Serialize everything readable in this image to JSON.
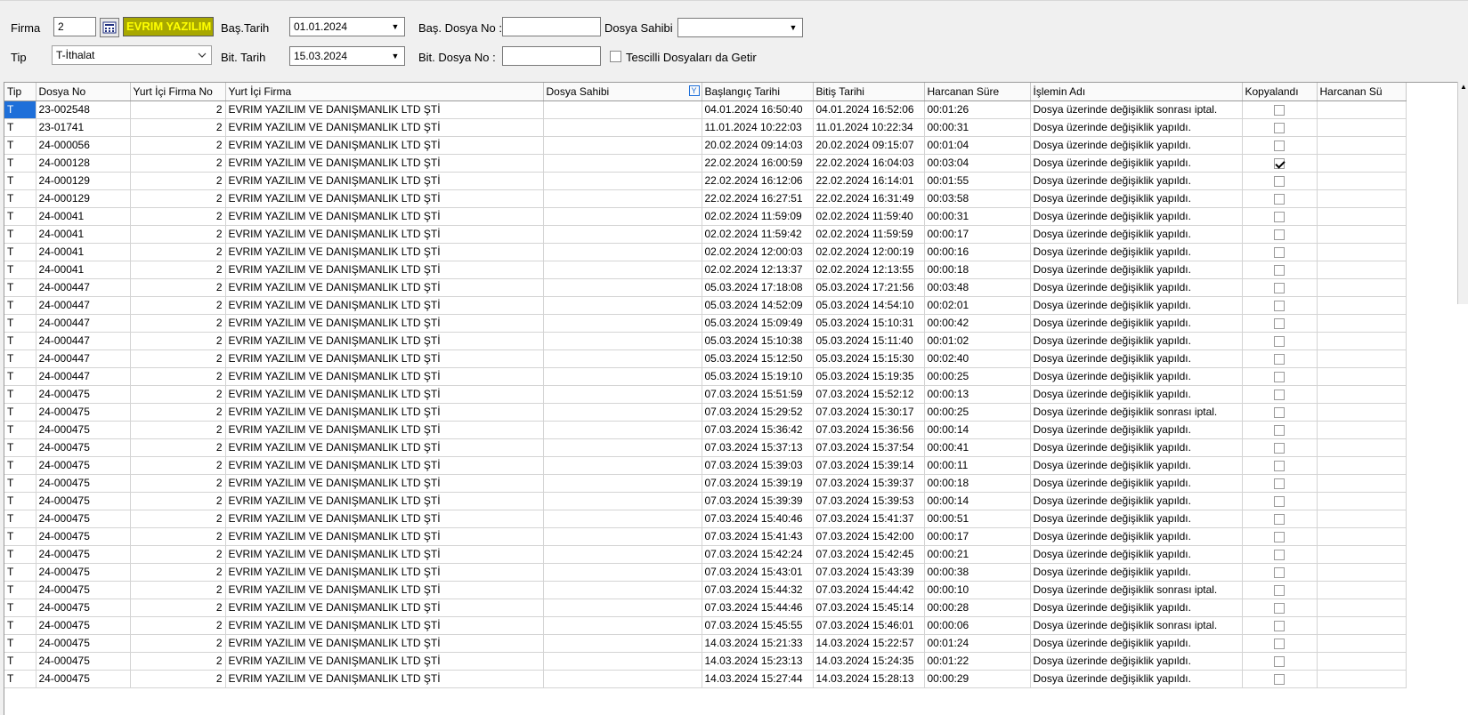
{
  "filters": {
    "firma_label": "Firma",
    "firma_value": "2",
    "firma_name": "EVRIM YAZILIM",
    "tip_label": "Tip",
    "tip_value": "T-İthalat",
    "bas_tarih_label": "Baş.Tarih",
    "bas_tarih_value": "01.01.2024",
    "bit_tarih_label": "Bit. Tarih",
    "bit_tarih_value": "15.03.2024",
    "bas_dosya_label": "Baş. Dosya No :",
    "bas_dosya_value": "",
    "bit_dosya_label": "Bit. Dosya No :",
    "bit_dosya_value": "",
    "dosya_sahibi_label": "Dosya Sahibi",
    "dosya_sahibi_value": "",
    "tescilli_label": "Tescilli Dosyaları da Getir"
  },
  "columns": [
    "Tip",
    "Dosya No",
    "Yurt İçi Firma No",
    "Yurt İçi Firma",
    "Dosya Sahibi",
    "Başlangıç Tarihi",
    "Bitiş Tarihi",
    "Harcanan Süre",
    "İşlemin Adı",
    "Kopyalandı",
    "Harcanan Sü"
  ],
  "rows": [
    {
      "tip": "T",
      "dosya": "23-002548",
      "firma_no": "2",
      "firma": "EVRIM YAZILIM VE DANIŞMANLIK LTD ŞTİ",
      "sahibi": "",
      "bas": "04.01.2024 16:50:40",
      "bit": "04.01.2024 16:52:06",
      "sure": "00:01:26",
      "islem": "Dosya üzerinde değişiklik sonrası iptal.",
      "kopya": false
    },
    {
      "tip": "T",
      "dosya": "23-01741",
      "firma_no": "2",
      "firma": "EVRIM YAZILIM VE DANIŞMANLIK LTD ŞTİ",
      "sahibi": "",
      "bas": "11.01.2024 10:22:03",
      "bit": "11.01.2024 10:22:34",
      "sure": "00:00:31",
      "islem": "Dosya üzerinde değişiklik yapıldı.",
      "kopya": false
    },
    {
      "tip": "T",
      "dosya": "24-000056",
      "firma_no": "2",
      "firma": "EVRIM YAZILIM VE DANIŞMANLIK LTD ŞTİ",
      "sahibi": "",
      "bas": "20.02.2024 09:14:03",
      "bit": "20.02.2024 09:15:07",
      "sure": "00:01:04",
      "islem": "Dosya üzerinde değişiklik yapıldı.",
      "kopya": false
    },
    {
      "tip": "T",
      "dosya": "24-000128",
      "firma_no": "2",
      "firma": "EVRIM YAZILIM VE DANIŞMANLIK LTD ŞTİ",
      "sahibi": "",
      "bas": "22.02.2024 16:00:59",
      "bit": "22.02.2024 16:04:03",
      "sure": "00:03:04",
      "islem": "Dosya üzerinde değişiklik yapıldı.",
      "kopya": true
    },
    {
      "tip": "T",
      "dosya": "24-000129",
      "firma_no": "2",
      "firma": "EVRIM YAZILIM VE DANIŞMANLIK LTD ŞTİ",
      "sahibi": "",
      "bas": "22.02.2024 16:12:06",
      "bit": "22.02.2024 16:14:01",
      "sure": "00:01:55",
      "islem": "Dosya üzerinde değişiklik yapıldı.",
      "kopya": false
    },
    {
      "tip": "T",
      "dosya": "24-000129",
      "firma_no": "2",
      "firma": "EVRIM YAZILIM VE DANIŞMANLIK LTD ŞTİ",
      "sahibi": "",
      "bas": "22.02.2024 16:27:51",
      "bit": "22.02.2024 16:31:49",
      "sure": "00:03:58",
      "islem": "Dosya üzerinde değişiklik yapıldı.",
      "kopya": false
    },
    {
      "tip": "T",
      "dosya": "24-00041",
      "firma_no": "2",
      "firma": "EVRIM YAZILIM VE DANIŞMANLIK LTD ŞTİ",
      "sahibi": "",
      "bas": "02.02.2024 11:59:09",
      "bit": "02.02.2024 11:59:40",
      "sure": "00:00:31",
      "islem": "Dosya üzerinde değişiklik yapıldı.",
      "kopya": false
    },
    {
      "tip": "T",
      "dosya": "24-00041",
      "firma_no": "2",
      "firma": "EVRIM YAZILIM VE DANIŞMANLIK LTD ŞTİ",
      "sahibi": "",
      "bas": "02.02.2024 11:59:42",
      "bit": "02.02.2024 11:59:59",
      "sure": "00:00:17",
      "islem": "Dosya üzerinde değişiklik yapıldı.",
      "kopya": false
    },
    {
      "tip": "T",
      "dosya": "24-00041",
      "firma_no": "2",
      "firma": "EVRIM YAZILIM VE DANIŞMANLIK LTD ŞTİ",
      "sahibi": "",
      "bas": "02.02.2024 12:00:03",
      "bit": "02.02.2024 12:00:19",
      "sure": "00:00:16",
      "islem": "Dosya üzerinde değişiklik yapıldı.",
      "kopya": false
    },
    {
      "tip": "T",
      "dosya": "24-00041",
      "firma_no": "2",
      "firma": "EVRIM YAZILIM VE DANIŞMANLIK LTD ŞTİ",
      "sahibi": "",
      "bas": "02.02.2024 12:13:37",
      "bit": "02.02.2024 12:13:55",
      "sure": "00:00:18",
      "islem": "Dosya üzerinde değişiklik yapıldı.",
      "kopya": false
    },
    {
      "tip": "T",
      "dosya": "24-000447",
      "firma_no": "2",
      "firma": "EVRIM YAZILIM VE DANIŞMANLIK LTD ŞTİ",
      "sahibi": "",
      "bas": "05.03.2024 17:18:08",
      "bit": "05.03.2024 17:21:56",
      "sure": "00:03:48",
      "islem": "Dosya üzerinde değişiklik yapıldı.",
      "kopya": false
    },
    {
      "tip": "T",
      "dosya": "24-000447",
      "firma_no": "2",
      "firma": "EVRIM YAZILIM VE DANIŞMANLIK LTD ŞTİ",
      "sahibi": "",
      "bas": "05.03.2024 14:52:09",
      "bit": "05.03.2024 14:54:10",
      "sure": "00:02:01",
      "islem": "Dosya üzerinde değişiklik yapıldı.",
      "kopya": false
    },
    {
      "tip": "T",
      "dosya": "24-000447",
      "firma_no": "2",
      "firma": "EVRIM YAZILIM VE DANIŞMANLIK LTD ŞTİ",
      "sahibi": "",
      "bas": "05.03.2024 15:09:49",
      "bit": "05.03.2024 15:10:31",
      "sure": "00:00:42",
      "islem": "Dosya üzerinde değişiklik yapıldı.",
      "kopya": false
    },
    {
      "tip": "T",
      "dosya": "24-000447",
      "firma_no": "2",
      "firma": "EVRIM YAZILIM VE DANIŞMANLIK LTD ŞTİ",
      "sahibi": "",
      "bas": "05.03.2024 15:10:38",
      "bit": "05.03.2024 15:11:40",
      "sure": "00:01:02",
      "islem": "Dosya üzerinde değişiklik yapıldı.",
      "kopya": false
    },
    {
      "tip": "T",
      "dosya": "24-000447",
      "firma_no": "2",
      "firma": "EVRIM YAZILIM VE DANIŞMANLIK LTD ŞTİ",
      "sahibi": "",
      "bas": "05.03.2024 15:12:50",
      "bit": "05.03.2024 15:15:30",
      "sure": "00:02:40",
      "islem": "Dosya üzerinde değişiklik yapıldı.",
      "kopya": false
    },
    {
      "tip": "T",
      "dosya": "24-000447",
      "firma_no": "2",
      "firma": "EVRIM YAZILIM VE DANIŞMANLIK LTD ŞTİ",
      "sahibi": "",
      "bas": "05.03.2024 15:19:10",
      "bit": "05.03.2024 15:19:35",
      "sure": "00:00:25",
      "islem": "Dosya üzerinde değişiklik yapıldı.",
      "kopya": false
    },
    {
      "tip": "T",
      "dosya": "24-000475",
      "firma_no": "2",
      "firma": "EVRIM YAZILIM VE DANIŞMANLIK LTD ŞTİ",
      "sahibi": "",
      "bas": "07.03.2024 15:51:59",
      "bit": "07.03.2024 15:52:12",
      "sure": "00:00:13",
      "islem": "Dosya üzerinde değişiklik yapıldı.",
      "kopya": false
    },
    {
      "tip": "T",
      "dosya": "24-000475",
      "firma_no": "2",
      "firma": "EVRIM YAZILIM VE DANIŞMANLIK LTD ŞTİ",
      "sahibi": "",
      "bas": "07.03.2024 15:29:52",
      "bit": "07.03.2024 15:30:17",
      "sure": "00:00:25",
      "islem": "Dosya üzerinde değişiklik sonrası iptal.",
      "kopya": false
    },
    {
      "tip": "T",
      "dosya": "24-000475",
      "firma_no": "2",
      "firma": "EVRIM YAZILIM VE DANIŞMANLIK LTD ŞTİ",
      "sahibi": "",
      "bas": "07.03.2024 15:36:42",
      "bit": "07.03.2024 15:36:56",
      "sure": "00:00:14",
      "islem": "Dosya üzerinde değişiklik yapıldı.",
      "kopya": false
    },
    {
      "tip": "T",
      "dosya": "24-000475",
      "firma_no": "2",
      "firma": "EVRIM YAZILIM VE DANIŞMANLIK LTD ŞTİ",
      "sahibi": "",
      "bas": "07.03.2024 15:37:13",
      "bit": "07.03.2024 15:37:54",
      "sure": "00:00:41",
      "islem": "Dosya üzerinde değişiklik yapıldı.",
      "kopya": false
    },
    {
      "tip": "T",
      "dosya": "24-000475",
      "firma_no": "2",
      "firma": "EVRIM YAZILIM VE DANIŞMANLIK LTD ŞTİ",
      "sahibi": "",
      "bas": "07.03.2024 15:39:03",
      "bit": "07.03.2024 15:39:14",
      "sure": "00:00:11",
      "islem": "Dosya üzerinde değişiklik yapıldı.",
      "kopya": false
    },
    {
      "tip": "T",
      "dosya": "24-000475",
      "firma_no": "2",
      "firma": "EVRIM YAZILIM VE DANIŞMANLIK LTD ŞTİ",
      "sahibi": "",
      "bas": "07.03.2024 15:39:19",
      "bit": "07.03.2024 15:39:37",
      "sure": "00:00:18",
      "islem": "Dosya üzerinde değişiklik yapıldı.",
      "kopya": false
    },
    {
      "tip": "T",
      "dosya": "24-000475",
      "firma_no": "2",
      "firma": "EVRIM YAZILIM VE DANIŞMANLIK LTD ŞTİ",
      "sahibi": "",
      "bas": "07.03.2024 15:39:39",
      "bit": "07.03.2024 15:39:53",
      "sure": "00:00:14",
      "islem": "Dosya üzerinde değişiklik yapıldı.",
      "kopya": false
    },
    {
      "tip": "T",
      "dosya": "24-000475",
      "firma_no": "2",
      "firma": "EVRIM YAZILIM VE DANIŞMANLIK LTD ŞTİ",
      "sahibi": "",
      "bas": "07.03.2024 15:40:46",
      "bit": "07.03.2024 15:41:37",
      "sure": "00:00:51",
      "islem": "Dosya üzerinde değişiklik yapıldı.",
      "kopya": false
    },
    {
      "tip": "T",
      "dosya": "24-000475",
      "firma_no": "2",
      "firma": "EVRIM YAZILIM VE DANIŞMANLIK LTD ŞTİ",
      "sahibi": "",
      "bas": "07.03.2024 15:41:43",
      "bit": "07.03.2024 15:42:00",
      "sure": "00:00:17",
      "islem": "Dosya üzerinde değişiklik yapıldı.",
      "kopya": false
    },
    {
      "tip": "T",
      "dosya": "24-000475",
      "firma_no": "2",
      "firma": "EVRIM YAZILIM VE DANIŞMANLIK LTD ŞTİ",
      "sahibi": "",
      "bas": "07.03.2024 15:42:24",
      "bit": "07.03.2024 15:42:45",
      "sure": "00:00:21",
      "islem": "Dosya üzerinde değişiklik yapıldı.",
      "kopya": false
    },
    {
      "tip": "T",
      "dosya": "24-000475",
      "firma_no": "2",
      "firma": "EVRIM YAZILIM VE DANIŞMANLIK LTD ŞTİ",
      "sahibi": "",
      "bas": "07.03.2024 15:43:01",
      "bit": "07.03.2024 15:43:39",
      "sure": "00:00:38",
      "islem": "Dosya üzerinde değişiklik yapıldı.",
      "kopya": false
    },
    {
      "tip": "T",
      "dosya": "24-000475",
      "firma_no": "2",
      "firma": "EVRIM YAZILIM VE DANIŞMANLIK LTD ŞTİ",
      "sahibi": "",
      "bas": "07.03.2024 15:44:32",
      "bit": "07.03.2024 15:44:42",
      "sure": "00:00:10",
      "islem": "Dosya üzerinde değişiklik sonrası iptal.",
      "kopya": false
    },
    {
      "tip": "T",
      "dosya": "24-000475",
      "firma_no": "2",
      "firma": "EVRIM YAZILIM VE DANIŞMANLIK LTD ŞTİ",
      "sahibi": "",
      "bas": "07.03.2024 15:44:46",
      "bit": "07.03.2024 15:45:14",
      "sure": "00:00:28",
      "islem": "Dosya üzerinde değişiklik yapıldı.",
      "kopya": false
    },
    {
      "tip": "T",
      "dosya": "24-000475",
      "firma_no": "2",
      "firma": "EVRIM YAZILIM VE DANIŞMANLIK LTD ŞTİ",
      "sahibi": "",
      "bas": "07.03.2024 15:45:55",
      "bit": "07.03.2024 15:46:01",
      "sure": "00:00:06",
      "islem": "Dosya üzerinde değişiklik sonrası iptal.",
      "kopya": false
    },
    {
      "tip": "T",
      "dosya": "24-000475",
      "firma_no": "2",
      "firma": "EVRIM YAZILIM VE DANIŞMANLIK LTD ŞTİ",
      "sahibi": "",
      "bas": "14.03.2024 15:21:33",
      "bit": "14.03.2024 15:22:57",
      "sure": "00:01:24",
      "islem": "Dosya üzerinde değişiklik yapıldı.",
      "kopya": false
    },
    {
      "tip": "T",
      "dosya": "24-000475",
      "firma_no": "2",
      "firma": "EVRIM YAZILIM VE DANIŞMANLIK LTD ŞTİ",
      "sahibi": "",
      "bas": "14.03.2024 15:23:13",
      "bit": "14.03.2024 15:24:35",
      "sure": "00:01:22",
      "islem": "Dosya üzerinde değişiklik yapıldı.",
      "kopya": false
    },
    {
      "tip": "T",
      "dosya": "24-000475",
      "firma_no": "2",
      "firma": "EVRIM YAZILIM VE DANIŞMANLIK LTD ŞTİ",
      "sahibi": "",
      "bas": "14.03.2024 15:27:44",
      "bit": "14.03.2024 15:28:13",
      "sure": "00:00:29",
      "islem": "Dosya üzerinde değişiklik yapıldı.",
      "kopya": false
    }
  ]
}
